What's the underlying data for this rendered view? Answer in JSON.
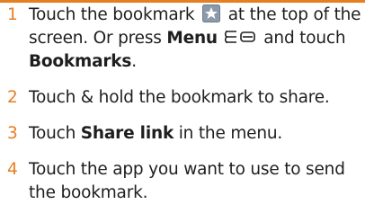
{
  "steps": [
    {
      "number": "1",
      "pre_icon": "Touch the bookmark",
      "icon": "bookmark-star-icon",
      "mid": "at the top of the screen. Or press",
      "bold1": "Menu",
      "icon2": "menu-key-icon",
      "post": "and touch",
      "bold2": "Bookmarks",
      "end": "."
    },
    {
      "number": "2",
      "text": "Touch & hold the bookmark to share."
    },
    {
      "number": "3",
      "pre": "Touch",
      "bold": "Share link",
      "post": "in the menu."
    },
    {
      "number": "4",
      "text": "Touch the app you want to use to send the bookmark."
    }
  ],
  "colors": {
    "accent": "#e67e22",
    "text": "#1e1e1e",
    "icon_bg": "#8a9aa8"
  }
}
